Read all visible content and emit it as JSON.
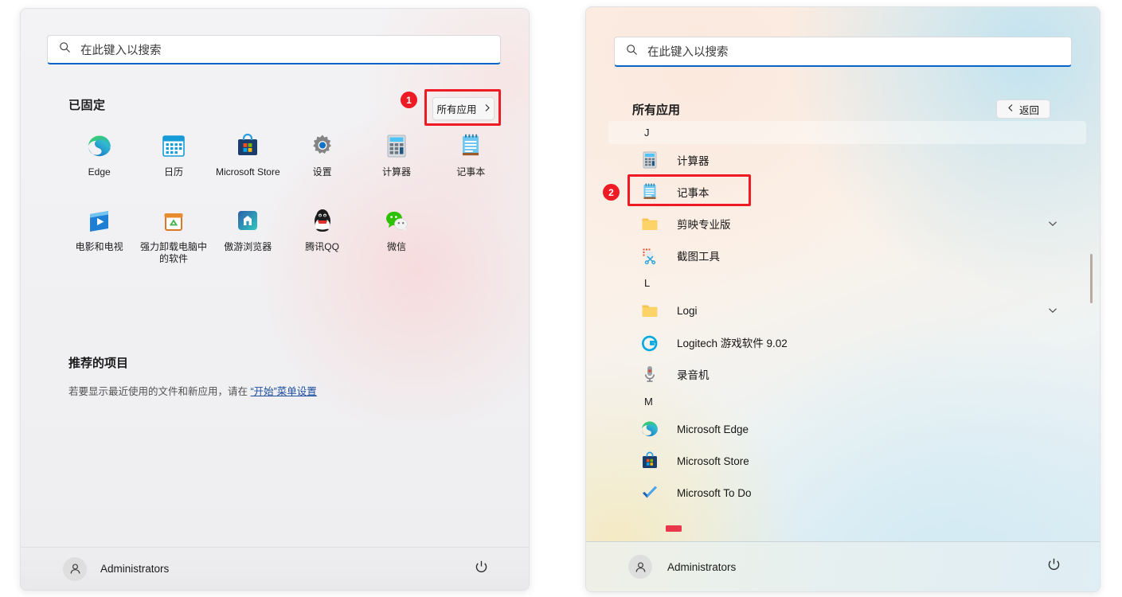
{
  "left_menu": {
    "search": {
      "placeholder": "在此键入以搜索",
      "icon": "search-icon"
    },
    "pinned_title": "已固定",
    "all_apps_button": {
      "label": "所有应用",
      "icon": "chevron-right-icon"
    },
    "annotation_1": "1",
    "pinned_apps": [
      {
        "label": "Edge",
        "icon": "edge-icon"
      },
      {
        "label": "日历",
        "icon": "calendar-icon"
      },
      {
        "label": "Microsoft Store",
        "icon": "microsoft-store-icon"
      },
      {
        "label": "设置",
        "icon": "settings-gear-icon"
      },
      {
        "label": "计算器",
        "icon": "calculator-icon"
      },
      {
        "label": "记事本",
        "icon": "notepad-icon"
      },
      {
        "label": "电影和电视",
        "icon": "movies-tv-icon"
      },
      {
        "label": "强力卸载电脑中的软件",
        "icon": "uninstaller-icon"
      },
      {
        "label": "傲游浏览器",
        "icon": "maxthon-browser-icon"
      },
      {
        "label": "腾讯QQ",
        "icon": "tencent-qq-icon"
      },
      {
        "label": "微信",
        "icon": "wechat-icon"
      }
    ],
    "recommended_title": "推荐的项目",
    "recommended_desc_prefix": "若要显示最近使用的文件和新应用，请在 ",
    "recommended_link": "“开始”菜单设置",
    "footer": {
      "user": "Administrators",
      "avatar": "user-avatar-icon",
      "power": "power-icon"
    }
  },
  "right_menu": {
    "search": {
      "placeholder": "在此键入以搜索",
      "icon": "search-icon"
    },
    "all_apps_title": "所有应用",
    "back_button": {
      "label": "返回",
      "icon": "chevron-left-icon"
    },
    "annotation_2": "2",
    "groups": [
      {
        "letter": "J",
        "highlighted": true,
        "apps": [
          {
            "label": "计算器",
            "icon": "calculator-icon",
            "expandable": false,
            "highlighted": false
          },
          {
            "label": "记事本",
            "icon": "notepad-icon",
            "expandable": false,
            "highlighted": true
          },
          {
            "label": "剪映专业版",
            "icon": "folder-icon",
            "expandable": true,
            "highlighted": false
          },
          {
            "label": "截图工具",
            "icon": "snipping-tool-icon",
            "expandable": false,
            "highlighted": false
          }
        ]
      },
      {
        "letter": "L",
        "highlighted": false,
        "apps": [
          {
            "label": "Logi",
            "icon": "folder-icon",
            "expandable": true,
            "highlighted": false
          },
          {
            "label": "Logitech 游戏软件 9.02",
            "icon": "logitech-g-icon",
            "expandable": false,
            "highlighted": false
          },
          {
            "label": "录音机",
            "icon": "voice-recorder-icon",
            "expandable": false,
            "highlighted": false
          }
        ]
      },
      {
        "letter": "M",
        "highlighted": false,
        "apps": [
          {
            "label": "Microsoft Edge",
            "icon": "edge-icon",
            "expandable": false,
            "highlighted": false
          },
          {
            "label": "Microsoft Store",
            "icon": "microsoft-store-icon",
            "expandable": false,
            "highlighted": false
          },
          {
            "label": "Microsoft To Do",
            "icon": "microsoft-todo-icon",
            "expandable": false,
            "highlighted": false
          }
        ]
      }
    ],
    "footer": {
      "user": "Administrators",
      "avatar": "user-avatar-icon",
      "power": "power-icon"
    }
  },
  "colors": {
    "annotation_red": "#ee1b24",
    "search_underline_blue": "#0a63c9",
    "link_blue": "#1d4ea0"
  }
}
